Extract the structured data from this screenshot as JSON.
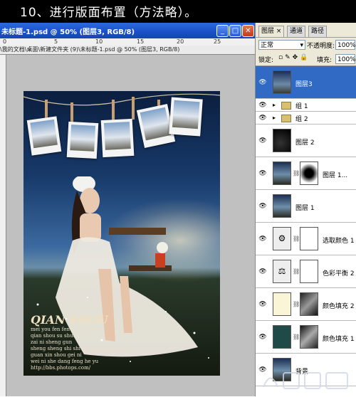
{
  "caption": "10、进行版面布置（方法略）。",
  "document": {
    "title": "未标题-1.psd @ 50% (图层3, RGB/8)",
    "path": "\\我的文档\\桌面\\新建文件夹 (9)\\未标题-1.psd @ 50% (图层3, RGB/8)",
    "ruler_marks": [
      "0",
      "5",
      "10",
      "15",
      "20",
      "25"
    ],
    "photo_text": {
      "title": "QIAN SHOU",
      "lines": [
        "mei you fen fen ao geng ai ni",
        "qian shou su shuo yi zi",
        "zai ni sheng gun",
        "sheng sheng shi shi yong yuan zai yi qi",
        "guan xin shou gei ni",
        "wei ni she dang feng he yu",
        "http://bbs.photops.com/"
      ]
    }
  },
  "panel": {
    "tabs": [
      "图层",
      "通道",
      "路径"
    ],
    "blend_mode": "正常",
    "opacity_label": "不透明度:",
    "opacity": "100%",
    "lock_label": "锁定:",
    "fill_label": "填充:",
    "fill": "100%",
    "layers": [
      {
        "name": "图层3",
        "selected": true,
        "type": "image"
      },
      {
        "name": "组 1",
        "type": "group"
      },
      {
        "name": "组 2",
        "type": "group"
      },
      {
        "name": "图层 2",
        "type": "image"
      },
      {
        "name": "图层 1...",
        "type": "masked"
      },
      {
        "name": "图层 1",
        "type": "image"
      },
      {
        "name": "选取颜色 1",
        "type": "adjust"
      },
      {
        "name": "色彩平衡 2",
        "type": "adjust"
      },
      {
        "name": "颜色填充 2",
        "type": "fill"
      },
      {
        "name": "颜色填充 1",
        "type": "fill"
      },
      {
        "name": "背景",
        "type": "image"
      }
    ]
  },
  "colors": {
    "selection": "#316ac5",
    "fill2_swatch": "#fbf5d8",
    "fill1_swatch": "#1f4a48"
  }
}
